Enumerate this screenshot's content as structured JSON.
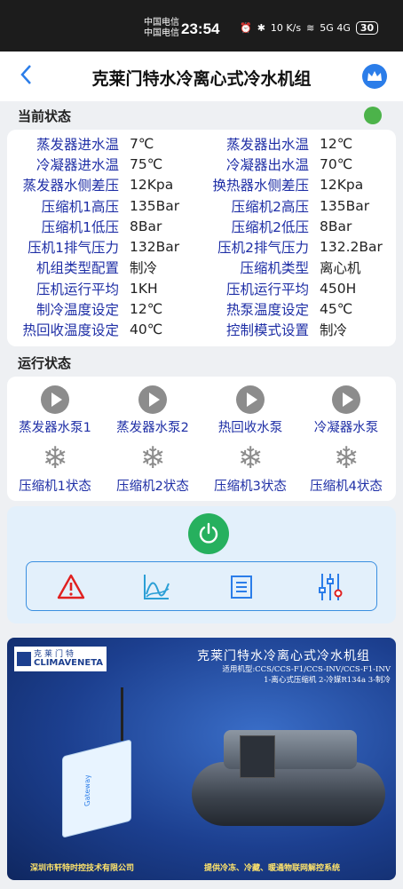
{
  "status_bar": {
    "carrier_1": "中国电信",
    "carrier_2": "中国电信",
    "time": "23:54",
    "net_speed": "10 K/s",
    "signal": "5G 4G",
    "battery": "30"
  },
  "header": {
    "title": "克莱门特水冷离心式冷水机组",
    "back_icon": "chevron-left-icon",
    "crown_icon": "crown-icon"
  },
  "current_status": {
    "title": "当前状态",
    "indicator_color": "#4cb34a",
    "rows": [
      {
        "label1": "蒸发器进水温",
        "value1": "7℃",
        "label2": "蒸发器出水温",
        "value2": "12℃"
      },
      {
        "label1": "冷凝器进水温",
        "value1": "75℃",
        "label2": "冷凝器出水温",
        "value2": "70℃"
      },
      {
        "label1": "蒸发器水侧差压",
        "value1": "12Kpa",
        "label2": "换热器水侧差压",
        "value2": "12Kpa"
      },
      {
        "label1": "压缩机1高压",
        "value1": "135Bar",
        "label2": "压缩机2高压",
        "value2": "135Bar"
      },
      {
        "label1": "压缩机1低压",
        "value1": "8Bar",
        "label2": "压缩机2低压",
        "value2": "8Bar"
      },
      {
        "label1": "压机1排气压力",
        "value1": "132Bar",
        "label2": "压机2排气压力",
        "value2": "132.2Bar"
      },
      {
        "label1": "机组类型配置",
        "value1": "制冷",
        "label2": "压缩机类型",
        "value2": "离心机"
      },
      {
        "label1": "压机运行平均",
        "value1": "1KH",
        "label2": "压机运行平均",
        "value2": "450H"
      },
      {
        "label1": "制冷温度设定",
        "value1": "12℃",
        "label2": "热泵温度设定",
        "value2": "45℃"
      },
      {
        "label1": "热回收温度设定",
        "value1": "40℃",
        "label2": "控制模式设置",
        "value2": "制冷"
      }
    ]
  },
  "run_status": {
    "title": "运行状态",
    "pumps": [
      {
        "label": "蒸发器水泵1",
        "icon": "play-icon"
      },
      {
        "label": "蒸发器水泵2",
        "icon": "play-icon"
      },
      {
        "label": "热回收水泵",
        "icon": "play-icon"
      },
      {
        "label": "冷凝器水泵",
        "icon": "play-icon"
      }
    ],
    "compressors": [
      {
        "label": "压缩机1状态",
        "icon": "snowflake-icon"
      },
      {
        "label": "压缩机2状态",
        "icon": "snowflake-icon"
      },
      {
        "label": "压缩机3状态",
        "icon": "snowflake-icon"
      },
      {
        "label": "压缩机4状态",
        "icon": "snowflake-icon"
      }
    ]
  },
  "controls": {
    "power_icon": "power-icon",
    "power_color": "#26b05e",
    "tools": [
      "alarm-icon",
      "trend-chart-icon",
      "list-icon",
      "settings-sliders-icon"
    ]
  },
  "banner": {
    "logo_cn": "克莱门特",
    "logo_en": "CLIMAVENETA",
    "title": "克莱门特水冷离心式冷水机组",
    "sub1": "适用机型:CCS/CCS-F1/CCS-INV/CCS-F1-INV",
    "sub2": "1-离心式压缩机 2-冷媒R134a 3-制冷",
    "gateway_label": "Gateway",
    "footer_left": "深圳市轩特时控技术有限公司",
    "footer_right": "提供冷冻、冷藏、暖通物联网解控系统"
  }
}
